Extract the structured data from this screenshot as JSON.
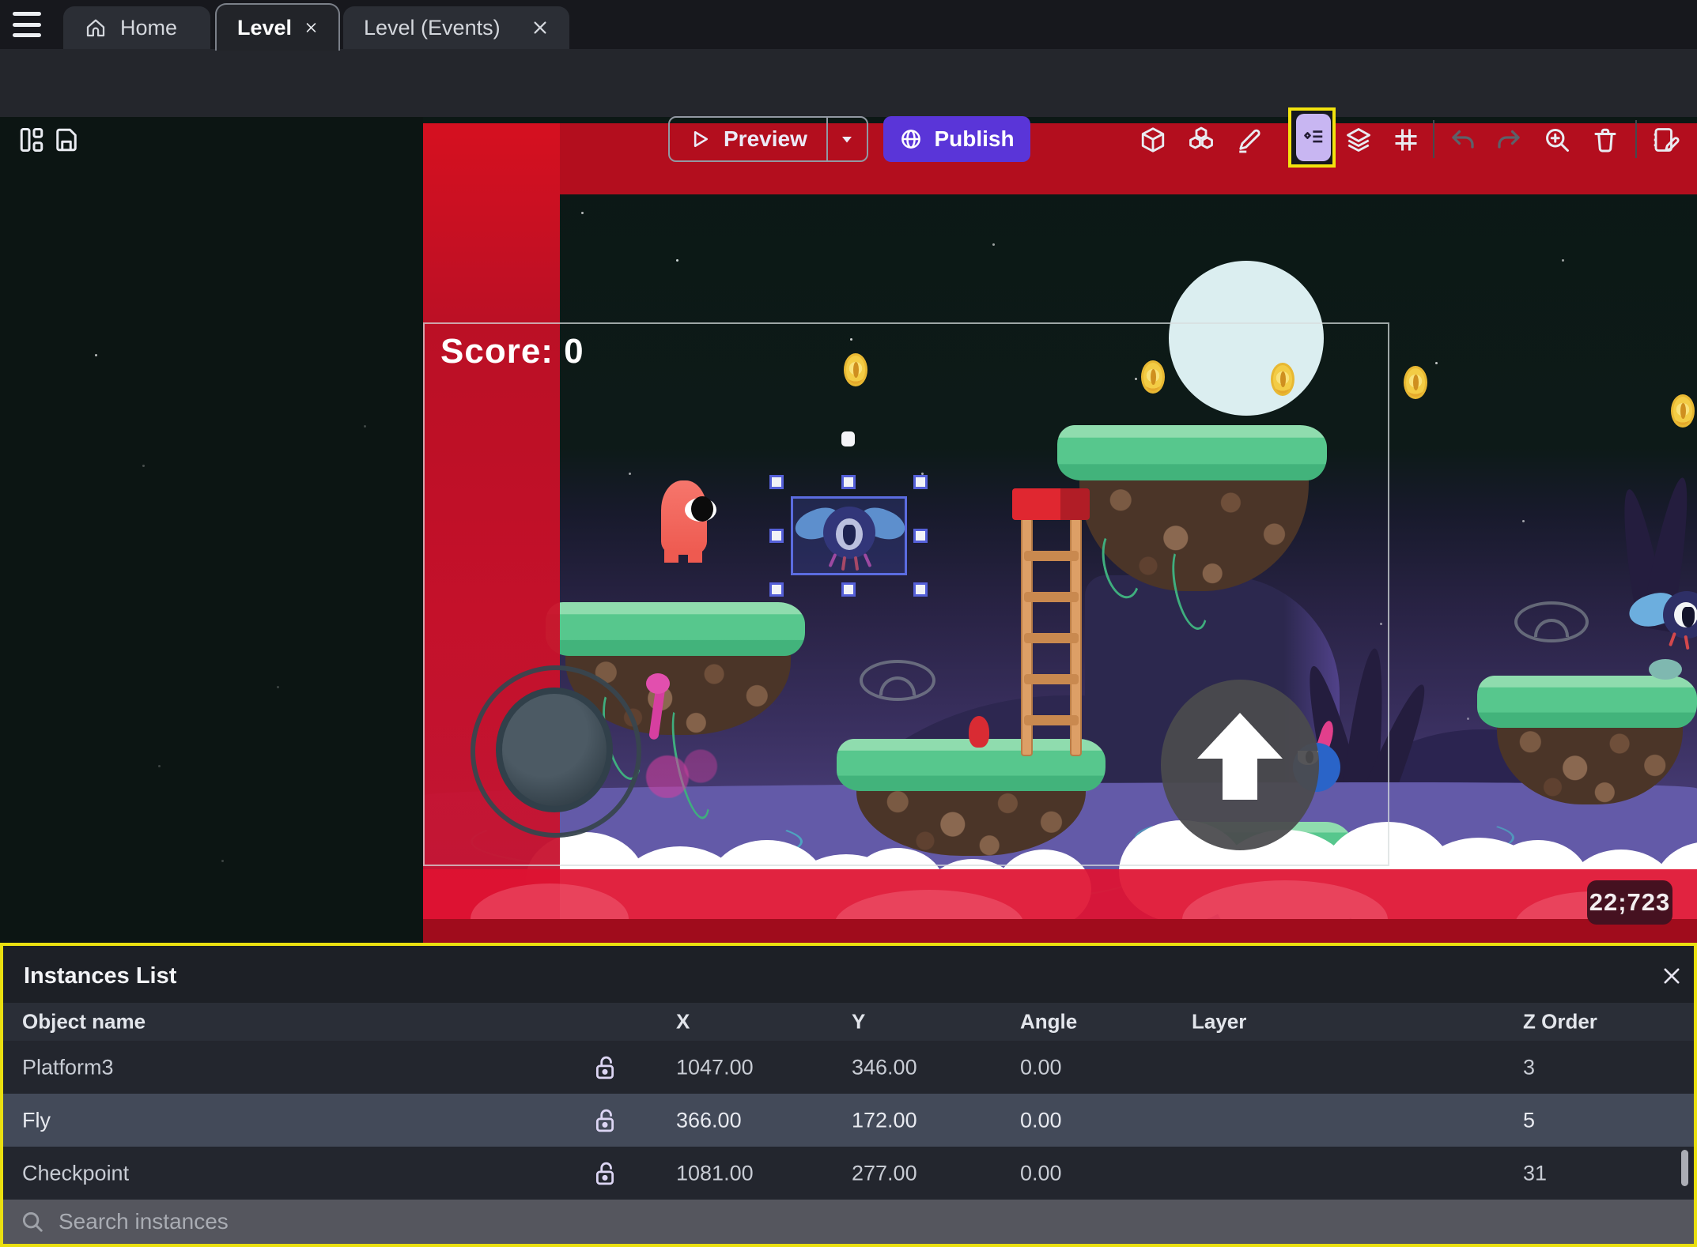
{
  "tabs": {
    "home": "Home",
    "level": "Level",
    "level_events": "Level (Events)"
  },
  "toolbar": {
    "preview_label": "Preview",
    "publish_label": "Publish",
    "icons": [
      "layout-panels",
      "save",
      "objects-cube",
      "object-groups",
      "edit-pencil",
      "instances-list",
      "layers",
      "grid",
      "undo",
      "redo",
      "zoom-in",
      "delete-trash",
      "edit-scene-properties"
    ]
  },
  "scene": {
    "score_text": "Score: 0",
    "coord_badge": "22;723",
    "selected_instance": "Fly"
  },
  "panel": {
    "title": "Instances List",
    "search_placeholder": "Search instances",
    "columns": {
      "name": "Object name",
      "x": "X",
      "y": "Y",
      "angle": "Angle",
      "layer": "Layer",
      "z": "Z Order"
    },
    "rows": [
      {
        "name": "Platform3",
        "x": "1047.00",
        "y": "346.00",
        "angle": "0.00",
        "layer": "",
        "z": "3"
      },
      {
        "name": "Fly",
        "x": "366.00",
        "y": "172.00",
        "angle": "0.00",
        "layer": "",
        "z": "5"
      },
      {
        "name": "Checkpoint",
        "x": "1081.00",
        "y": "277.00",
        "angle": "0.00",
        "layer": "",
        "z": "31"
      }
    ]
  },
  "colors": {
    "accent_purple": "#5a35d8",
    "highlight_yellow": "#f2e30e",
    "selection_blue": "#5b6ce0",
    "hazard_red": "#cc1029",
    "icon_highlight_bg": "#c8b6f2",
    "panel_bg": "#1d2026",
    "selected_row_bg": "#434a59"
  }
}
